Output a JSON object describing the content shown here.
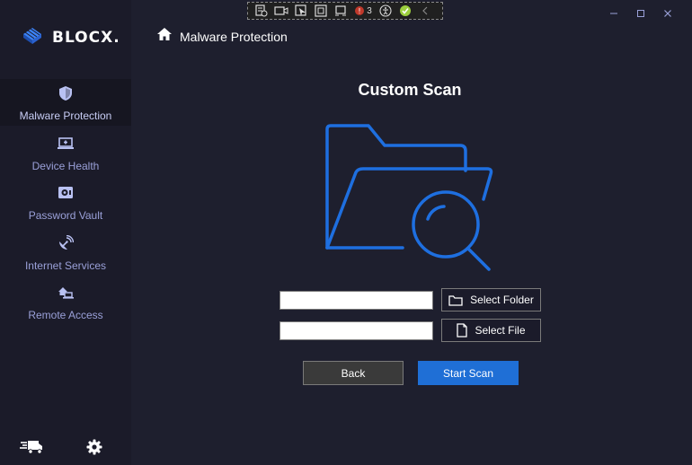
{
  "app": {
    "brand": "BLOCX."
  },
  "header": {
    "title": "Malware Protection"
  },
  "sidebar": {
    "items": [
      {
        "label": "Malware Protection",
        "icon": "shield-icon",
        "active": true
      },
      {
        "label": "Device Health",
        "icon": "laptop-medical-icon",
        "active": false
      },
      {
        "label": "Password Vault",
        "icon": "vault-icon",
        "active": false
      },
      {
        "label": "Internet Services",
        "icon": "satellite-dish-icon",
        "active": false
      },
      {
        "label": "Remote Access",
        "icon": "remote-laptop-icon",
        "active": false
      }
    ],
    "footer": {
      "left_icon": "fast-truck-icon",
      "right_icon": "gear-icon"
    }
  },
  "toolbar": {
    "badge_count": "3"
  },
  "main": {
    "title": "Custom Scan",
    "folder_input": {
      "value": "",
      "placeholder": ""
    },
    "file_input": {
      "value": "",
      "placeholder": ""
    },
    "select_folder_label": "Select Folder",
    "select_file_label": "Select File",
    "back_label": "Back",
    "start_scan_label": "Start Scan"
  },
  "colors": {
    "accent": "#1f6fd6",
    "illustration": "#1e6fe0",
    "nav_text": "#9aa0d8",
    "background": "#1e1f2e",
    "sidebar": "#1b1b29"
  }
}
